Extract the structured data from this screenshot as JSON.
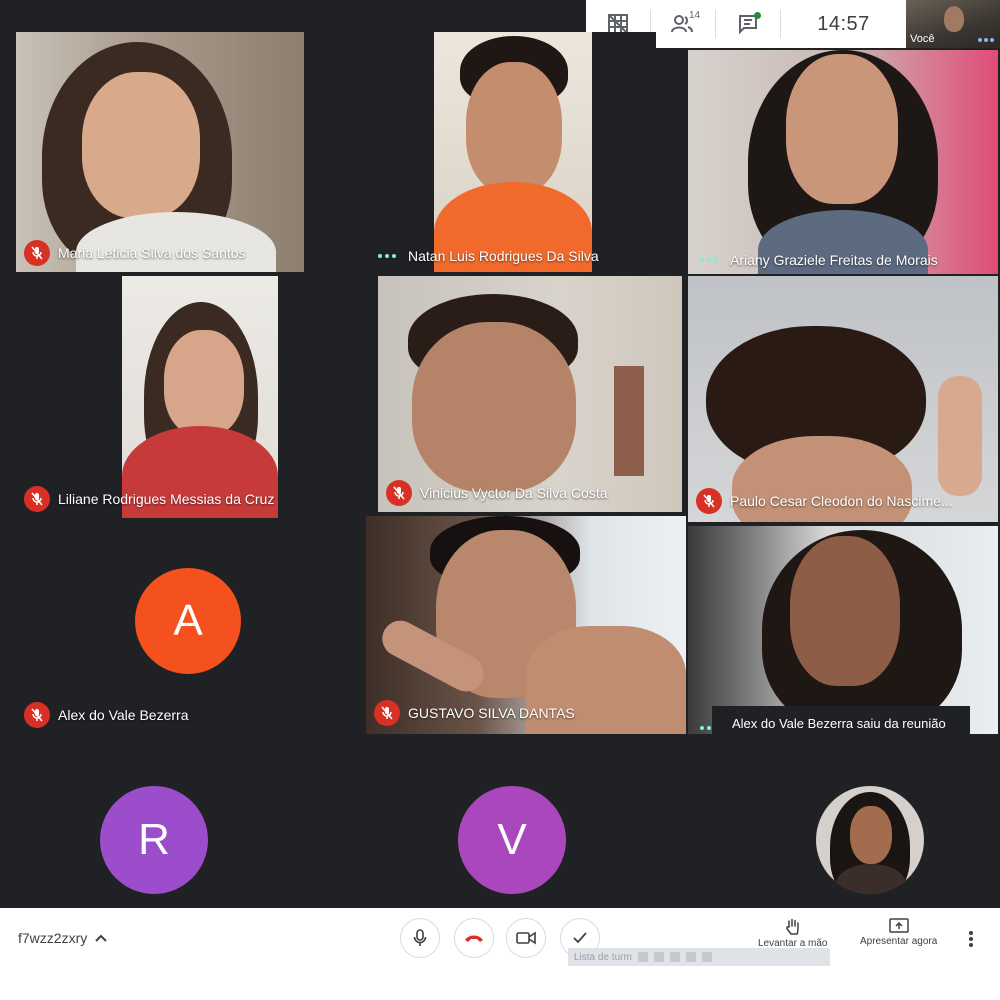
{
  "top_bar": {
    "participant_count": "14",
    "time": "14:57",
    "self_label": "Você"
  },
  "tiles": [
    {
      "name": "Maria Leticia Silva dos Santos",
      "status": "muted"
    },
    {
      "name": "Natan Luis Rodrigues Da Silva",
      "status": "speaking"
    },
    {
      "name": "Ariany Graziele Freitas de Morais",
      "status": "speaking"
    },
    {
      "name": "Liliane Rodrigues Messias da Cruz",
      "status": "muted"
    },
    {
      "name": "Vinicius Vyctor Da Silva Costa",
      "status": "muted"
    },
    {
      "name": "Paulo Cesar Cleodon do Nascime...",
      "status": "muted"
    },
    {
      "name": "Alex do Vale Bezerra",
      "status": "muted",
      "avatar_letter": "A",
      "avatar_color": "#f4511e"
    },
    {
      "name": "GUSTAVO SILVA DANTAS",
      "status": "muted"
    },
    {
      "name": "",
      "status": "speaking"
    }
  ],
  "bottom_avatars": [
    {
      "letter": "R",
      "color": "#9c4dcc"
    },
    {
      "letter": "V",
      "color": "#ab47bc"
    },
    {
      "type": "photo"
    }
  ],
  "toast": "Alex do Vale Bezerra saiu da reunião",
  "bottom_bar": {
    "meeting_code": "f7wzz2zxry",
    "raise_hand_label": "Levantar a mão",
    "present_label": "Apresentar agora",
    "overlay_text": "Lista de turm"
  },
  "colors": {
    "background": "#202124",
    "mute_red": "#d93025",
    "hangup_red": "#d93025",
    "speaking_dots": "#7ef0d8"
  }
}
